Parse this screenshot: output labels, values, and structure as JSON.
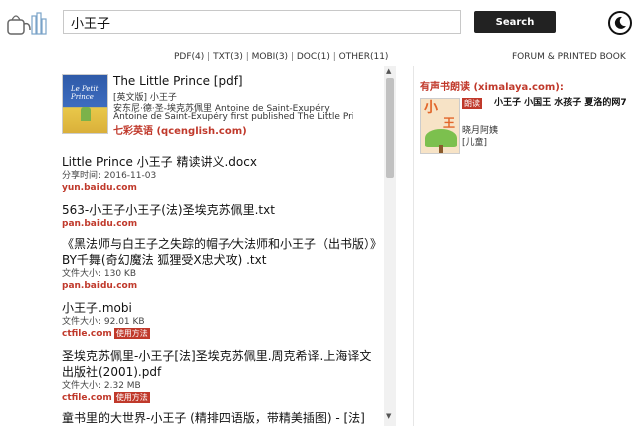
{
  "header": {
    "search_value": "小王子",
    "search_button": "Search",
    "theme_icon": "moon-icon",
    "logo_icon": "tea-kettle-logo"
  },
  "filters": [
    {
      "label": "PDF(4)"
    },
    {
      "label": "TXT(3)"
    },
    {
      "label": "MOBI(3)"
    },
    {
      "label": "DOC(1)"
    },
    {
      "label": "OTHER(11)"
    }
  ],
  "forum_link": "FORUM & PRINTED BOOK",
  "featured": {
    "cover_text": "Le Petit Prince",
    "title": "The Little Prince [pdf]",
    "edition": "[英文版] 小王子",
    "author": "安东尼·德·圣-埃克苏佩里 Antoine de Saint-Exupéry",
    "blurb": "Antoine de Saint-Exupéry first published The Little Pri",
    "source": "七彩英语 (qcenglish.com)"
  },
  "results": [
    {
      "title": "Little Prince 小王子 精读讲义.docx",
      "meta": "分享时间: 2016-11-03",
      "host": "yun.baidu.com",
      "howto": ""
    },
    {
      "title": "563-小王子小王子(法)圣埃克苏佩里.txt",
      "meta": "",
      "host": "pan.baidu.com",
      "howto": ""
    },
    {
      "title": "《黑法师与白王子之失踪的帽子⁄大法师和小王子（出书版）》BY千舞(奇幻魔法 狐狸受X忠犬攻) .txt",
      "meta": "文件大小: 130 KB",
      "host": "pan.baidu.com",
      "howto": ""
    },
    {
      "title": "小王子.mobi",
      "meta": "文件大小: 92.01 KB",
      "host": "ctfile.com",
      "howto": "使用方法"
    },
    {
      "title": "圣埃克苏佩里-小王子[法]圣埃克苏佩里.周克希译.上海译文出版社(2001).pdf",
      "meta": "文件大小: 2.32 MB",
      "host": "ctfile.com",
      "howto": "使用方法"
    },
    {
      "title": "童书里的大世界-小王子 (精排四语版，带精美插图) - [法]",
      "meta": "",
      "host": "",
      "howto": ""
    }
  ],
  "sidebar": {
    "title": "有声书朗读 (ximalaya.com):",
    "badge": "朗读",
    "book_title": "小王子 小国王 水孩子 夏洛的网7",
    "author": "晓月阿姨",
    "category": "[儿童]",
    "cover_text_1": "小",
    "cover_text_2": "王"
  },
  "colors": {
    "accent": "#c0392b",
    "button": "#222222"
  }
}
